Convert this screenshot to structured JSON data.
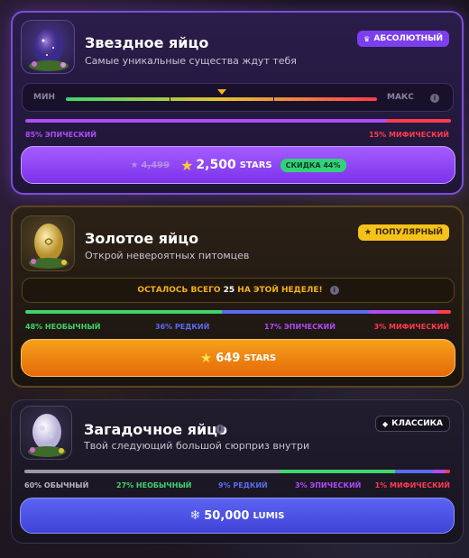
{
  "colors": {
    "purple": "#8a43f0",
    "orange": "#f08a12",
    "blue": "#4f55e6",
    "epic": "#b04bf5",
    "mythic": "#ff3b4e",
    "rare": "#5a6cf0",
    "uncommon": "#3fd56b",
    "common": "#9a98a8"
  },
  "cards": [
    {
      "title": "Звездное яйцо",
      "subtitle": "Самые уникальные существа ждут тебя",
      "badge": "АБСОЛЮТНЫЙ",
      "badge_icon": "crown-icon",
      "meter": {
        "min_label": "МИН",
        "max_label": "МАКС",
        "level": 0.5
      },
      "odds": [
        {
          "label": "85% ЭПИЧЕСКИЙ",
          "value": 85,
          "color": "#b04bf5"
        },
        {
          "label": "15% МИФИЧЕСКИЙ",
          "value": 15,
          "color": "#ff3b4e"
        }
      ],
      "button": {
        "old_price": "4,499",
        "price": "2,500",
        "currency": "STARS",
        "discount": "СКИДКА 44%"
      }
    },
    {
      "title": "Золотое яйцо",
      "subtitle": "Открой невероятных питомцев",
      "badge": "ПОПУЛЯРНЫЙ",
      "badge_icon": "star-icon",
      "notice": {
        "prefix": "ОСТАЛОСЬ ВСЕГО ",
        "count": "25",
        "suffix": " НА ЭТОЙ НЕДЕЛЕ!"
      },
      "odds": [
        {
          "label": "48% НЕОБЫЧНЫЙ",
          "value": 48,
          "color": "#3fd56b"
        },
        {
          "label": "36% РЕДКИЙ",
          "value": 36,
          "color": "#5a6cf0"
        },
        {
          "label": "17% ЭПИЧЕСКИЙ",
          "value": 17,
          "color": "#b04bf5"
        },
        {
          "label": "3% МИФИЧЕСКИЙ",
          "value": 3,
          "color": "#ff3b4e"
        }
      ],
      "button": {
        "price": "649",
        "currency": "STARS"
      }
    },
    {
      "title": "Загадочное яйцо",
      "subtitle": "Твой следующий большой сюрприз внутри",
      "badge": "КЛАССИКА",
      "badge_icon": "diamond-icon",
      "odds": [
        {
          "label": "60% ОБЫЧНЫЙ",
          "value": 60,
          "color": "#9a98a8"
        },
        {
          "label": "27% НЕОБЫЧНЫЙ",
          "value": 27,
          "color": "#3fd56b"
        },
        {
          "label": "9% РЕДКИЙ",
          "value": 9,
          "color": "#5a6cf0"
        },
        {
          "label": "3% ЭПИЧЕСКИЙ",
          "value": 3,
          "color": "#b04bf5"
        },
        {
          "label": "1% МИФИЧЕСКИЙ",
          "value": 1,
          "color": "#ff3b4e"
        }
      ],
      "button": {
        "price": "50,000",
        "currency": "LUMIS"
      }
    }
  ]
}
